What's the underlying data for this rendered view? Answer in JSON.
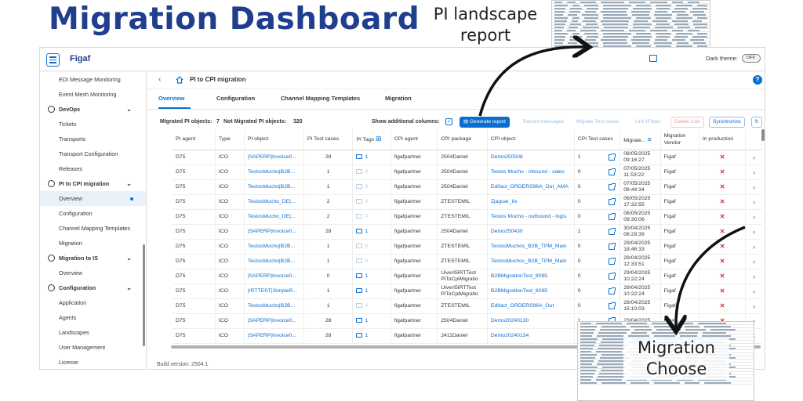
{
  "hero_title": "Migration Dashboard",
  "callouts": {
    "pi_landscape": "PI landscape report",
    "migration_choose": "Migration Choose"
  },
  "shell": {
    "brand": "Figaf",
    "dark_theme_label": "Dark theme:",
    "dark_theme_value": "OFF"
  },
  "sidebar": {
    "items": [
      {
        "label": "EDI Message Monitoring",
        "type": "item"
      },
      {
        "label": "Event Mesh Monitoring",
        "type": "item"
      },
      {
        "label": "DevOps",
        "type": "group",
        "icon": "devops-icon"
      },
      {
        "label": "Tickets",
        "type": "item"
      },
      {
        "label": "Transports",
        "type": "item"
      },
      {
        "label": "Transport Configuration",
        "type": "item"
      },
      {
        "label": "Releases",
        "type": "item"
      },
      {
        "label": "PI to CPI migration",
        "type": "group",
        "icon": "migration-icon"
      },
      {
        "label": "Overview",
        "type": "item",
        "active": true
      },
      {
        "label": "Configuration",
        "type": "item"
      },
      {
        "label": "Channel Mapping Templates",
        "type": "item"
      },
      {
        "label": "Migration",
        "type": "item"
      },
      {
        "label": "Migration to IS",
        "type": "group",
        "icon": "migration-is-icon"
      },
      {
        "label": "Overview",
        "type": "item"
      },
      {
        "label": "Configuration",
        "type": "group",
        "icon": "gear-icon"
      },
      {
        "label": "Application",
        "type": "item"
      },
      {
        "label": "Agents",
        "type": "item"
      },
      {
        "label": "Landscapes",
        "type": "item"
      },
      {
        "label": "User Management",
        "type": "item"
      },
      {
        "label": "License",
        "type": "item"
      }
    ]
  },
  "page": {
    "title": "PI to CPI migration",
    "tabs": [
      "Overview",
      "Configuration",
      "Channel Mapping Templates",
      "Migration"
    ]
  },
  "toolbar": {
    "migrated_label": "Migrated PI objects:",
    "migrated_count": "7",
    "not_migrated_label": "Not Migrated PI objects:",
    "not_migrated_count": "320",
    "show_columns_label": "Show additional columns:",
    "buttons": {
      "generate_report": "Generate report",
      "record_messages": "Record messages",
      "migrate_test_cases": "Migrate Test cases",
      "link_iflows": "Link IFlows",
      "delete_link": "Delete Link",
      "synchronize": "Synchronize"
    }
  },
  "table": {
    "columns": [
      "PI agent",
      "Type",
      "PI object",
      "PI Test cases",
      "PI Tags",
      "CPI agent",
      "CPI package",
      "CPI object",
      "CPI Test cases",
      "Migrate...",
      "Migration Vendor",
      "In production"
    ],
    "rows": [
      {
        "pi_agent": "D75",
        "type": "ICO",
        "pi_object": "|SAPERP|Invoice0...",
        "pi_tests": "28",
        "pi_tags": "1",
        "cpi_agent": "figafpartner",
        "cpi_package": "2504Daniel",
        "cpi_object": "Demo250508",
        "cpi_tests": "1",
        "migrated": "08/05/2025 09:16:27",
        "vendor": "Figaf"
      },
      {
        "pi_agent": "D75",
        "type": "ICO",
        "pi_object": "TestosMucho|B2B...",
        "pi_tests": "1",
        "pi_tags": "0",
        "cpi_agent": "figafpartner",
        "cpi_package": "2504Daniel",
        "cpi_object": "Testos Mucho - inbound - sales",
        "cpi_tests": "0",
        "migrated": "07/05/2025 11:53:22",
        "vendor": "Figaf"
      },
      {
        "pi_agent": "D75",
        "type": "ICO",
        "pi_object": "TestosMucho|B2B...",
        "pi_tests": "1",
        "pi_tags": "0",
        "cpi_agent": "figafpartner",
        "cpi_package": "2504Daniel",
        "cpi_object": "Edifact_ORDERS96A_Out_AMA",
        "cpi_tests": "0",
        "migrated": "07/05/2025 08:44:34",
        "vendor": "Figaf"
      },
      {
        "pi_agent": "D75",
        "type": "ICO",
        "pi_object": "TestosMucho_DE|...",
        "pi_tests": "2",
        "pi_tags": "0",
        "cpi_agent": "figafpartner",
        "cpi_package": "ZTESTEMIL",
        "cpi_object": "Zjaguar_itx",
        "cpi_tests": "0",
        "migrated": "06/05/2025 17:32:55",
        "vendor": "Figaf"
      },
      {
        "pi_agent": "D75",
        "type": "ICO",
        "pi_object": "TestosMucho_DE|...",
        "pi_tests": "2",
        "pi_tags": "0",
        "cpi_agent": "figafpartner",
        "cpi_package": "ZTESTEMIL",
        "cpi_object": "Testos Mucho - outbound - logis",
        "cpi_tests": "0",
        "migrated": "06/05/2025 09:30:06",
        "vendor": "Figaf"
      },
      {
        "pi_agent": "D75",
        "type": "ICO",
        "pi_object": "|SAPERP|Invoice0...",
        "pi_tests": "28",
        "pi_tags": "1",
        "cpi_agent": "figafpartner",
        "cpi_package": "2504Daniel",
        "cpi_object": "Demo250430",
        "cpi_tests": "1",
        "migrated": "30/04/2025 08:29:39",
        "vendor": "Figaf"
      },
      {
        "pi_agent": "D75",
        "type": "ICO",
        "pi_object": "TestosMucho|B2B...",
        "pi_tests": "1",
        "pi_tags": "0",
        "cpi_agent": "figafpartner",
        "cpi_package": "ZTESTEMIL",
        "cpi_object": "TestosMuchos_B2B_TPM_Main",
        "cpi_tests": "0",
        "migrated": "29/04/2025 18:46:33",
        "vendor": "Figaf"
      },
      {
        "pi_agent": "D75",
        "type": "ICO",
        "pi_object": "TestosMucho|B2B...",
        "pi_tests": "1",
        "pi_tags": "0",
        "cpi_agent": "figafpartner",
        "cpi_package": "ZTESTEMIL",
        "cpi_object": "TestosMuchos_B2B_TPM_Main",
        "cpi_tests": "0",
        "migrated": "29/04/2025 12:33:51",
        "vendor": "Figaf"
      },
      {
        "pi_agent": "D75",
        "type": "ICO",
        "pi_object": "|SAPERP|Invoice0...",
        "pi_tests": "0",
        "pi_tags": "1",
        "cpi_agent": "figafpartner",
        "cpi_package": "UiverI5IRTTest PiToCpiMigratio",
        "cpi_object": "B2BMigrationTest_8095",
        "cpi_tests": "0",
        "migrated": "29/04/2025 10:22:24",
        "vendor": "Figaf"
      },
      {
        "pi_agent": "D75",
        "type": "ICO",
        "pi_object": "|IRTTEST|SimpleR...",
        "pi_tests": "1",
        "pi_tags": "1",
        "cpi_agent": "figafpartner",
        "cpi_package": "UiverI5IRTTest PiToCpiMigratio",
        "cpi_object": "B2BMigrationTest_8095",
        "cpi_tests": "0",
        "migrated": "29/04/2025 10:22:24",
        "vendor": "Figaf"
      },
      {
        "pi_agent": "D75",
        "type": "ICO",
        "pi_object": "TestosMucho|B2B...",
        "pi_tests": "1",
        "pi_tags": "0",
        "cpi_agent": "figafpartner",
        "cpi_package": "ZTESTEMIL",
        "cpi_object": "Edifact_ORDERS96A_Out",
        "cpi_tests": "0",
        "migrated": "28/04/2025 15:10:03",
        "vendor": "Figaf"
      },
      {
        "pi_agent": "D75",
        "type": "ICO",
        "pi_object": "|SAPERP|Invoice0...",
        "pi_tests": "28",
        "pi_tags": "1",
        "cpi_agent": "figafpartner",
        "cpi_package": "2504Daniel",
        "cpi_object": "Demo20240130",
        "cpi_tests": "1",
        "migrated": "23/04/2025",
        "vendor": "Figaf"
      },
      {
        "pi_agent": "D75",
        "type": "ICO",
        "pi_object": "|SAPERP|Invoice0...",
        "pi_tests": "28",
        "pi_tags": "1",
        "cpi_agent": "figafpartner",
        "cpi_package": "2411Daniel",
        "cpi_object": "Demo20240134",
        "cpi_tests": "0",
        "migrated": "",
        "vendor": "Figaf"
      }
    ]
  },
  "build_version": "Build version: 2504.1",
  "colors": {
    "hero": "#1f3e8e",
    "accent": "#0a6ed1",
    "error": "#e02b27"
  }
}
